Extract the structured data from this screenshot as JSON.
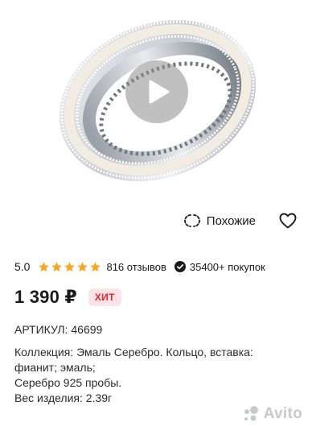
{
  "product_image": {
    "icon": "play-icon"
  },
  "actions": {
    "similar_label": "Похожие",
    "similar_icon": "similar-icon",
    "favorite_icon": "heart-icon"
  },
  "rating": {
    "value": "5.0",
    "stars": 5,
    "reviews": "816 отзывов",
    "purchases": "35400+ покупок",
    "star_color": "#f5a623"
  },
  "price": {
    "amount": "1 390 ₽",
    "badge": "ХИТ",
    "badge_color": "#e3262e"
  },
  "description": {
    "article": "АРТИКУЛ: 46699",
    "line1": "Коллекция: Эмаль Серебро. Кольцо, вставка:",
    "line2": "фианит; эмаль;",
    "line3": "Серебро 925 пробы.",
    "line4": "Вес изделия: 2.39г"
  },
  "watermark": {
    "text": "Avito"
  }
}
